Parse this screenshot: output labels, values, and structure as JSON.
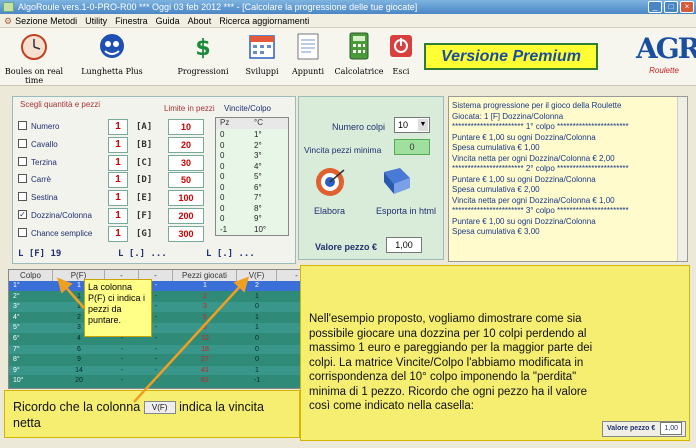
{
  "window": {
    "title": "AlgoRoule vers.1-0-PRO-R00   ***  Oggi 03 feb 2012  ***  - [Calcolare la progressione delle tue giocate]"
  },
  "menu": [
    "Sezione Metodi",
    "Utility",
    "Finestra",
    "Guida",
    "About",
    "Ricerca aggiornamenti"
  ],
  "toolbar": {
    "boules": "Boules on real time",
    "lunghetta": "Lunghetta Plus",
    "progressioni": "Progressioni",
    "sviluppi": "Sviluppi",
    "appunti": "Appunti",
    "calcolatrice": "Calcolatrice",
    "esci": "Esci",
    "premium": "Versione Premium",
    "logo_text": "AGR",
    "logo_sub": "Roulette"
  },
  "selection": {
    "group_label": "Scegli quantità e pezzi",
    "limit_header": "Limite in pezzi",
    "vincite_header": "Vincite/Colpo",
    "rows": [
      {
        "label": "Numero",
        "qty": "1",
        "code": "[A]",
        "limit": "10",
        "checked": false
      },
      {
        "label": "Cavallo",
        "qty": "1",
        "code": "[B]",
        "limit": "20",
        "checked": false
      },
      {
        "label": "Terzina",
        "qty": "1",
        "code": "[C]",
        "limit": "30",
        "checked": false
      },
      {
        "label": "Carrè",
        "qty": "1",
        "code": "[D]",
        "limit": "50",
        "checked": false
      },
      {
        "label": "Sestina",
        "qty": "1",
        "code": "[E]",
        "limit": "100",
        "checked": false
      },
      {
        "label": "Dozzina/Colonna",
        "qty": "1",
        "code": "[F]",
        "limit": "200",
        "checked": true
      },
      {
        "label": "Chance semplice",
        "qty": "1",
        "code": "[G]",
        "limit": "300",
        "checked": false
      }
    ],
    "check_mark": "✓"
  },
  "vincite_table": {
    "headers": [
      "Pz",
      "°C"
    ],
    "rows": [
      [
        "0",
        "1°"
      ],
      [
        "0",
        "2°"
      ],
      [
        "0",
        "3°"
      ],
      [
        "0",
        "4°"
      ],
      [
        "0",
        "5°"
      ],
      [
        "0",
        "6°"
      ],
      [
        "0",
        "7°"
      ],
      [
        "0",
        "8°"
      ],
      [
        "0",
        "9°"
      ],
      [
        "-1",
        "10°"
      ]
    ]
  },
  "status_line": {
    "left": "L [F] 19",
    "mid": "L [.]  ...",
    "right": "L [.]  ..."
  },
  "controls": {
    "numero_colpi_label": "Numero colpi",
    "numero_colpi_value": "10",
    "vincita_label": "Vincita pezzi minima",
    "vincita_value": "0",
    "elabora_label": "Elabora",
    "esporta_label": "Esporta in html",
    "valore_label": "Valore pezzo €",
    "valore_value": "1,00"
  },
  "report": {
    "lines": [
      "Sistema progressione per il gioco della Roulette",
      "Giocata: 1 [F] Dozzina/Colonna",
      "*********************** 1° colpo ***********************",
      "Puntare € 1,00 su ogni Dozzina/Colonna",
      "Spesa cumulativa € 1,00",
      "Vincita netta per ogni Dozzina/Colonna  € 2,00",
      "*********************** 2° colpo ***********************",
      "Puntare € 1,00 su ogni Dozzina/Colonna",
      "Spesa cumulativa € 2,00",
      "Vincita netta per ogni Dozzina/Colonna  € 1,00",
      "*********************** 3° colpo ***********************",
      "Puntare € 1,00 su ogni Dozzina/Colonna",
      "Spesa cumulativa € 3,00"
    ]
  },
  "grid": {
    "headers": [
      "Colpo",
      "P(F)",
      "-",
      "-",
      "Pezzi giocati",
      "V(F)",
      "-",
      "-",
      "-",
      "-"
    ],
    "rows": [
      {
        "colpo": "1°",
        "pf": "1",
        "pezzi": "1",
        "vf": "2"
      },
      {
        "colpo": "2°",
        "pf": "1",
        "pezzi": "2",
        "vf": "1"
      },
      {
        "colpo": "3°",
        "pf": "1",
        "pezzi": "3",
        "vf": "0"
      },
      {
        "colpo": "4°",
        "pf": "2",
        "pezzi": "5",
        "vf": "1"
      },
      {
        "colpo": "5°",
        "pf": "3",
        "pezzi": "8",
        "vf": "1"
      },
      {
        "colpo": "6°",
        "pf": "4",
        "pezzi": "12",
        "vf": "0"
      },
      {
        "colpo": "7°",
        "pf": "6",
        "pezzi": "18",
        "vf": "0"
      },
      {
        "colpo": "8°",
        "pf": "9",
        "pezzi": "27",
        "vf": "0"
      },
      {
        "colpo": "9°",
        "pf": "14",
        "pezzi": "41",
        "vf": "1"
      },
      {
        "colpo": "10°",
        "pf": "20",
        "pezzi": "61",
        "vf": "-1"
      }
    ],
    "dash": "-"
  },
  "annotations": {
    "pf_note": "La colonna P(F) ci indica i pezzi da puntare.",
    "main_note": "Nell'esempio proposto, vogliamo dimostrare come sia possibile giocare una dozzina per 10 colpi perdendo al massimo 1 euro e pareggiando per la maggior parte dei colpi. La matrice Vincite/Colpo l'abbiamo modificata in corrispondenza del 10° colpo imponendo la \"perdita\" minima di 1 pezzo. Ricordo che ogni pezzo ha il valore così come indicato nella casella:",
    "vf_note_before": "Ricordo che la colonna",
    "vf_note_icon": "V(F)",
    "vf_note_after": "indica la vincita netta",
    "inset_label": "Valore pezzo €",
    "inset_value": "1,00"
  },
  "colors": {
    "highlight": "#3a6fd8",
    "grid_bg": "#2f8a78",
    "accent_red": "#cc0000",
    "note_bg": "#f5ee70"
  }
}
